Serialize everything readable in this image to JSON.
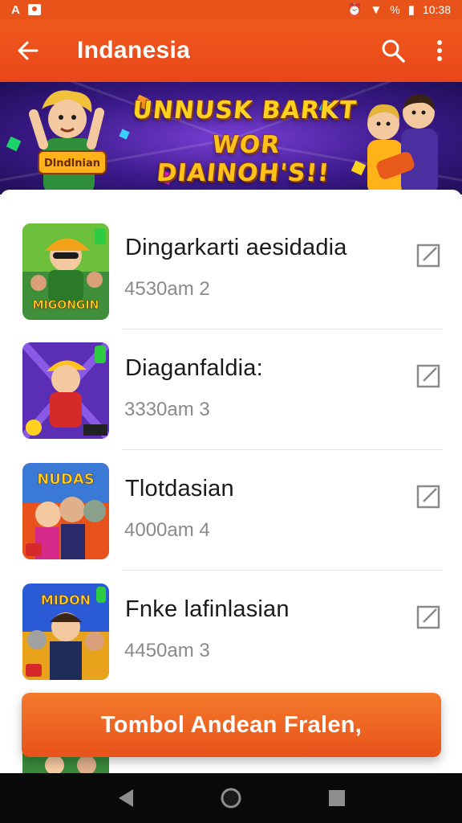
{
  "status_bar": {
    "left_text": "A",
    "time": "10:38",
    "signal": "%"
  },
  "app_bar": {
    "title": "Indanesia"
  },
  "banner": {
    "line1": "UNNUSK BARKT",
    "line2": "WOR DIAINOH'S!!",
    "badge_left": "Dlndlnian"
  },
  "list": [
    {
      "title": "Dingarkarti aesidadia",
      "subtitle": "4530am 2",
      "thumb_label": "MIGONGIN"
    },
    {
      "title": "Diaganfaldia:",
      "subtitle": "3330am 3",
      "thumb_label": ""
    },
    {
      "title": "Tlotdasian",
      "subtitle": "4000am 4",
      "thumb_label": "NUDAS"
    },
    {
      "title": "Fnke lafinlasian",
      "subtitle": "4450am 3",
      "thumb_label": "MIDON"
    }
  ],
  "cta": {
    "label": "Tombol Andean Fralen,"
  },
  "icons": {
    "back": "arrow-left-icon",
    "search": "search-icon",
    "more": "more-vert-icon",
    "open": "open-external-icon",
    "nav_back": "triangle-back-icon",
    "nav_home": "circle-home-icon",
    "nav_recents": "square-recents-icon"
  },
  "colors": {
    "primary": "#e8521b",
    "banner_bg": "#3b1a8a",
    "text": "#1a1a1a",
    "subtext": "#8a8a8a"
  }
}
